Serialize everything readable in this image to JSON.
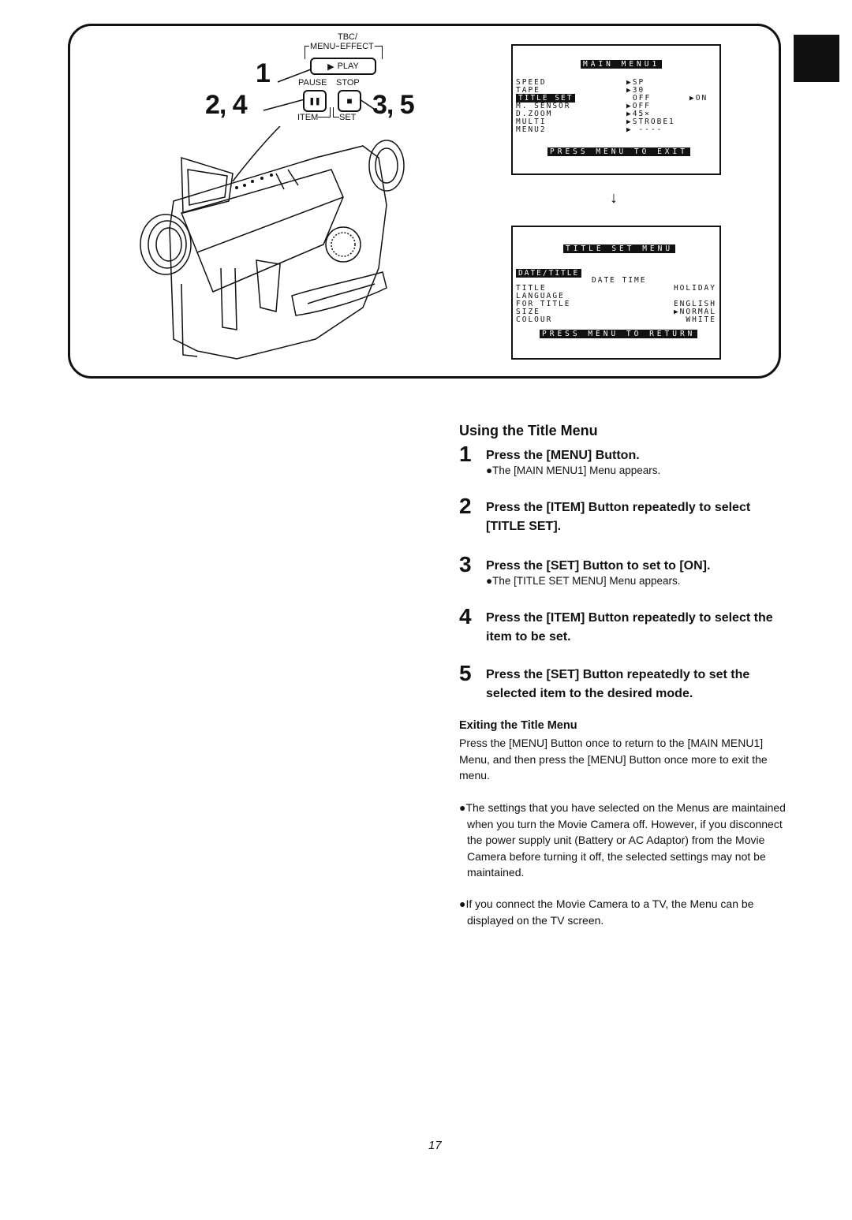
{
  "diagram": {
    "button_labels": {
      "tbc": "TBC/",
      "menu": "MENU",
      "effect": "EFFECT",
      "play": "PLAY",
      "pause": "PAUSE",
      "stop": "STOP",
      "item": "ITEM",
      "set": "SET"
    },
    "callouts": {
      "menu": "1",
      "item": "2, 4",
      "set": "3, 5"
    },
    "icons": {
      "play": "▶",
      "pause": "❚❚",
      "stop": "■"
    }
  },
  "main_menu": {
    "title": "MAIN MENU1",
    "rows": [
      {
        "label": "SPEED",
        "value": "▶SP",
        "extra": ""
      },
      {
        "label": "TAPE",
        "value": "▶30",
        "extra": ""
      },
      {
        "label": "TITLE SET",
        "value": "OFF",
        "extra": "▶ON",
        "highlighted": true
      },
      {
        "label": "M. SENSOR",
        "value": "▶OFF",
        "extra": ""
      },
      {
        "label": "D.ZOOM",
        "value": "▶45×",
        "extra": ""
      },
      {
        "label": "MULTI",
        "value": "▶STROBE1",
        "extra": ""
      },
      {
        "label": "MENU2",
        "value": "▶ ----",
        "extra": ""
      }
    ],
    "footer": "PRESS MENU TO EXIT"
  },
  "title_set_menu": {
    "title": "TITLE SET MENU",
    "section": "DATE/TITLE",
    "section_value": "DATE TIME",
    "rows": [
      {
        "label": "TITLE",
        "value": "HOLIDAY"
      },
      {
        "label": "LANGUAGE",
        "value": ""
      },
      {
        "label": "FOR TITLE",
        "value": "ENGLISH"
      },
      {
        "label": "SIZE",
        "value": "▶NORMAL"
      },
      {
        "label": "COLOUR",
        "value": "WHITE"
      }
    ],
    "footer": "PRESS MENU TO RETURN"
  },
  "transition_arrow": "↓",
  "instructions": {
    "title": "Using the Title Menu",
    "steps": [
      {
        "num": "1",
        "heading": "Press the [MENU] Button.",
        "note": "●The [MAIN MENU1] Menu appears."
      },
      {
        "num": "2",
        "heading": "Press the [ITEM] Button repeatedly to select [TITLE SET].",
        "note": ""
      },
      {
        "num": "3",
        "heading": "Press the [SET] Button to set to [ON].",
        "note": "●The [TITLE SET MENU] Menu appears."
      },
      {
        "num": "4",
        "heading": "Press the [ITEM] Button repeatedly to select the item to be set.",
        "note": ""
      },
      {
        "num": "5",
        "heading": "Press the [SET] Button repeatedly to set the selected item to the desired mode.",
        "note": ""
      }
    ],
    "exiting": {
      "title": "Exiting the Title Menu",
      "text": "Press the [MENU] Button once to return to the [MAIN MENU1] Menu, and then press the [MENU] Button once more to exit the menu."
    },
    "notes": [
      "●The settings that you have selected on the Menus are maintained when you turn the Movie Camera off. However, if you disconnect the power supply unit (Battery or AC Adaptor) from the Movie Camera before turning it off, the selected settings may not be maintained.",
      "●If you connect the Movie Camera to a TV, the Menu can be displayed on the TV screen."
    ]
  },
  "page_number": "17"
}
